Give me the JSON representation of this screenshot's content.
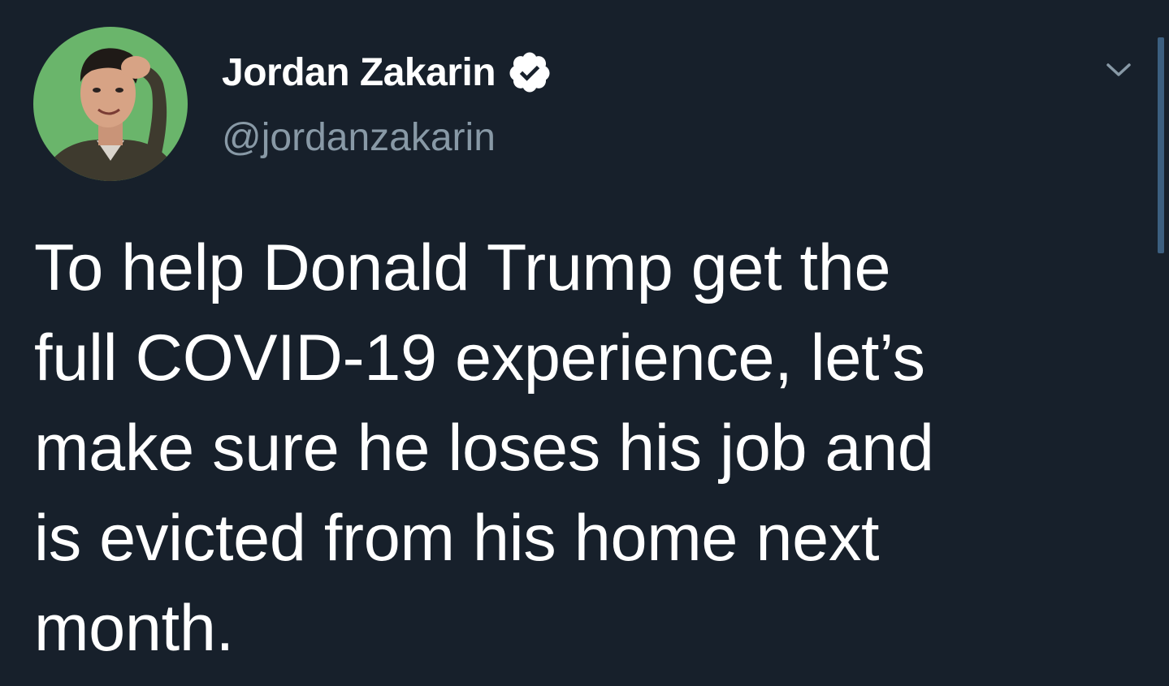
{
  "tweet": {
    "author": {
      "display_name": "Jordan Zakarin",
      "handle": "@jordanzakarin",
      "verified": true,
      "avatar_icon": "profile-photo"
    },
    "text_lines": [
      "To help Donald Trump get the",
      "full COVID-19 experience, let’s",
      "make sure he loses his job and",
      "is evicted from his home next",
      "month."
    ],
    "menu_icon": "chevron-down-icon"
  },
  "colors": {
    "background": "#17202b",
    "text": "#ffffff",
    "secondary_text": "#8899a6",
    "scrollbar": "#3c5f80",
    "avatar_bg": "#6ab56b"
  }
}
